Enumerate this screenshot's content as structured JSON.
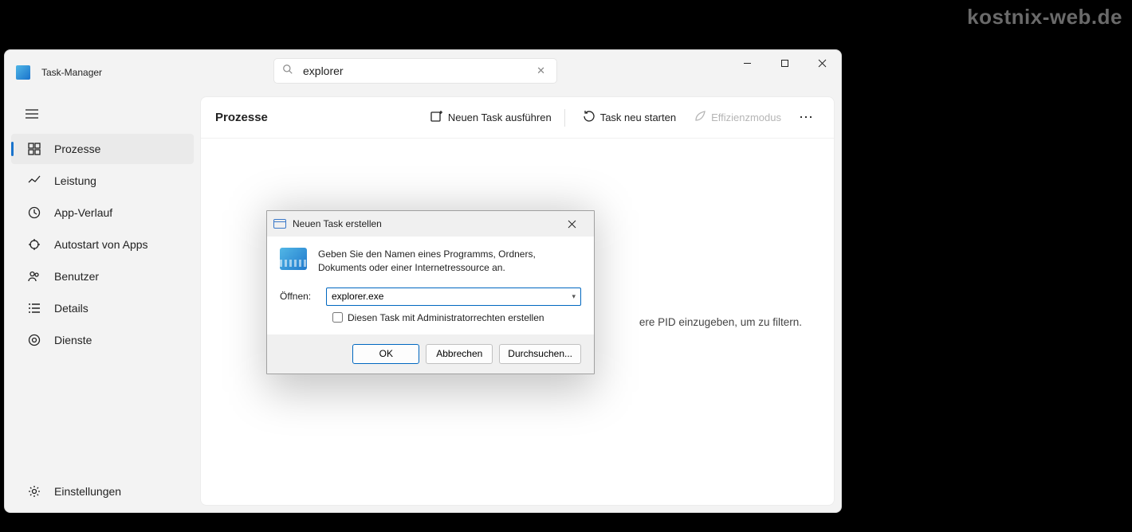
{
  "watermark": "kostnix-web.de",
  "window": {
    "title": "Task-Manager",
    "search": {
      "value": "explorer"
    },
    "controls": {
      "minimize": "minimize",
      "maximize": "maximize",
      "close": "close"
    }
  },
  "sidebar": {
    "items": [
      {
        "label": "Prozesse"
      },
      {
        "label": "Leistung"
      },
      {
        "label": "App-Verlauf"
      },
      {
        "label": "Autostart von Apps"
      },
      {
        "label": "Benutzer"
      },
      {
        "label": "Details"
      },
      {
        "label": "Dienste"
      }
    ],
    "settings": "Einstellungen"
  },
  "header": {
    "title": "Prozesse",
    "new_task": "Neuen Task ausführen",
    "restart_task": "Task neu starten",
    "efficiency": "Effizienzmodus"
  },
  "hint": "ere PID einzugeben, um zu filtern.",
  "dialog": {
    "title": "Neuen Task erstellen",
    "description": "Geben Sie den Namen eines Programms, Ordners, Dokuments oder einer Internetressource an.",
    "open_label": "Öffnen:",
    "open_value": "explorer.exe",
    "admin_checkbox": "Diesen Task mit Administratorrechten erstellen",
    "ok": "OK",
    "cancel": "Abbrechen",
    "browse": "Durchsuchen..."
  }
}
